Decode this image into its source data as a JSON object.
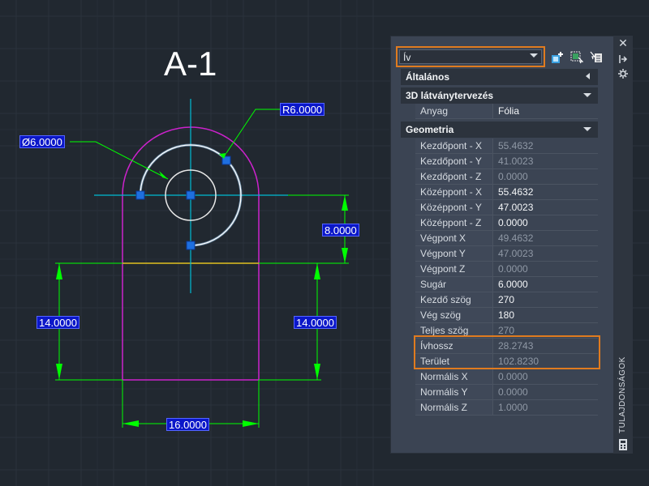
{
  "drawing": {
    "title": "A-1",
    "dimensions": {
      "radius": "R6.0000",
      "diameter": "Ø6.0000",
      "vertical_small": "8.0000",
      "left_height": "14.0000",
      "right_height": "14.0000",
      "bottom_width": "16.0000"
    }
  },
  "palette": {
    "selector_value": "Ív",
    "side_label": "TULAJDONSÁGOK",
    "sections": {
      "general": "Általános",
      "visual3d": "3D látványtervezés",
      "geometry": "Geometria"
    },
    "visual3d_rows": [
      {
        "name": "Anyag",
        "value": "Fólia"
      }
    ],
    "geometry_rows": [
      {
        "name": "Kezdőpont - X",
        "value": "55.4632"
      },
      {
        "name": "Kezdőpont - Y",
        "value": "41.0023"
      },
      {
        "name": "Kezdőpont - Z",
        "value": "0.0000"
      },
      {
        "name": "Középpont - X",
        "value": "55.4632"
      },
      {
        "name": "Középpont - Y",
        "value": "47.0023"
      },
      {
        "name": "Középpont - Z",
        "value": "0.0000"
      },
      {
        "name": "Végpont X",
        "value": "49.4632"
      },
      {
        "name": "Végpont Y",
        "value": "47.0023"
      },
      {
        "name": "Végpont Z",
        "value": "0.0000"
      },
      {
        "name": "Sugár",
        "value": "6.0000"
      },
      {
        "name": "Kezdő szög",
        "value": "270"
      },
      {
        "name": "Vég szög",
        "value": "180"
      },
      {
        "name": "Teljes szög",
        "value": "270"
      },
      {
        "name": "Ívhossz",
        "value": "28.2743"
      },
      {
        "name": "Terület",
        "value": "102.8230"
      },
      {
        "name": "Normális X",
        "value": "0.0000"
      },
      {
        "name": "Normális Y",
        "value": "0.0000"
      },
      {
        "name": "Normális Z",
        "value": "1.0000"
      }
    ]
  },
  "icons": {
    "close": "close-icon",
    "pin": "pin-icon",
    "settings": "settings-icon",
    "quick_select": "quick-select-icon",
    "select_objects": "select-objects-icon",
    "toggle_pickadd": "toggle-pickadd-icon",
    "calculator": "calculator-icon"
  },
  "colors": {
    "background": "#212830",
    "dimension": "#00ff00",
    "outline": "#cc22cc",
    "centerline": "#00bcd4",
    "highlight": "#e07b1f",
    "dim_label_bg": "#0b17c9"
  }
}
